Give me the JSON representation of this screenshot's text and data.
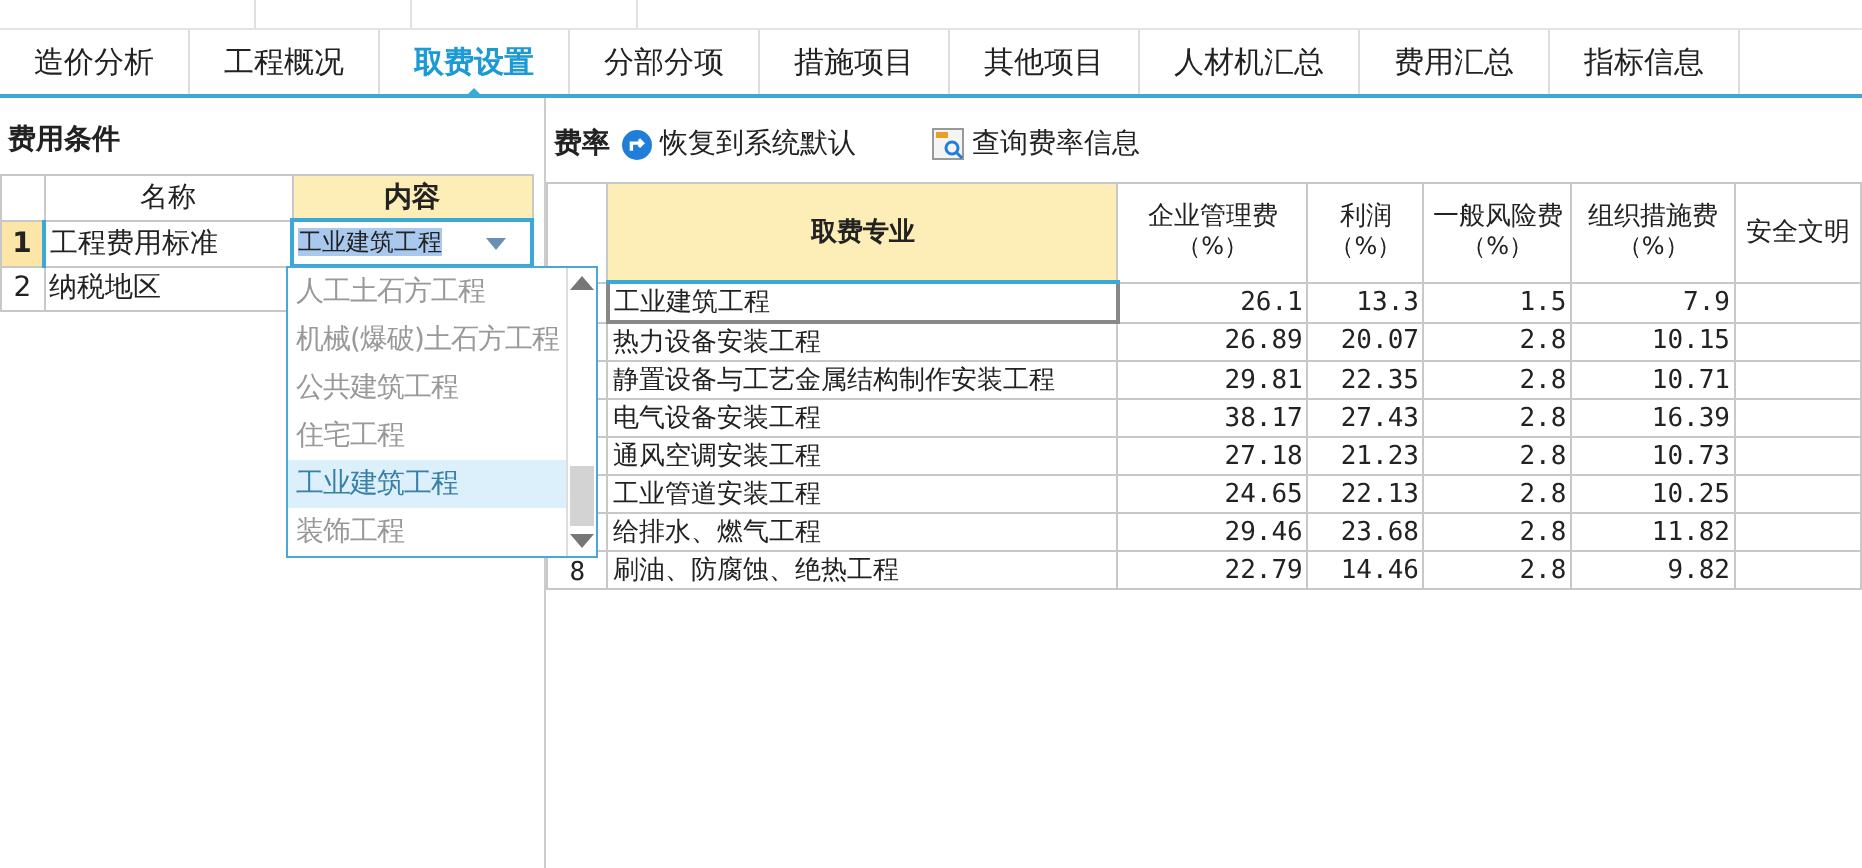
{
  "tabs": [
    {
      "label": "造价分析",
      "selected": false
    },
    {
      "label": "工程概况",
      "selected": false
    },
    {
      "label": "取费设置",
      "selected": true
    },
    {
      "label": "分部分项",
      "selected": false
    },
    {
      "label": "措施项目",
      "selected": false
    },
    {
      "label": "其他项目",
      "selected": false
    },
    {
      "label": "人材机汇总",
      "selected": false
    },
    {
      "label": "费用汇总",
      "selected": false
    },
    {
      "label": "指标信息",
      "selected": false
    }
  ],
  "conditions": {
    "title": "费用条件",
    "columns": [
      "名称",
      "内容"
    ],
    "rows": [
      {
        "index": "1",
        "name": "工程费用标准",
        "value": "工业建筑工程",
        "selected": true
      },
      {
        "index": "2",
        "name": "纳税地区",
        "selected": false
      }
    ],
    "dropdown": {
      "options": [
        {
          "label": "人工土石方工程",
          "selected": false
        },
        {
          "label": "机械(爆破)土石方工程",
          "selected": false
        },
        {
          "label": "公共建筑工程",
          "selected": false
        },
        {
          "label": "住宅工程",
          "selected": false
        },
        {
          "label": "工业建筑工程",
          "selected": true
        },
        {
          "label": "装饰工程",
          "selected": false
        }
      ]
    }
  },
  "rates": {
    "title": "费率",
    "toolbar": [
      "恢复到系统默认",
      "查询费率信息"
    ],
    "columns": [
      {
        "title": "取费专业"
      },
      {
        "title": "企业管理费",
        "unit": "（%）"
      },
      {
        "title": "利润",
        "unit": "（%）"
      },
      {
        "title": "一般风险费",
        "unit": "（%）"
      },
      {
        "title": "组织措施费",
        "unit": "（%）"
      },
      {
        "title": "安全文明"
      }
    ],
    "rows": [
      {
        "cells": [
          "工业建筑工程",
          "26.1",
          "13.3",
          "1.5",
          "7.9"
        ],
        "selected": true
      },
      {
        "cells": [
          "热力设备安装工程",
          "26.89",
          "20.07",
          "2.8",
          "10.15"
        ],
        "selected": false
      },
      {
        "cells": [
          "静置设备与工艺金属结构制作安装工程",
          "29.81",
          "22.35",
          "2.8",
          "10.71"
        ],
        "selected": false
      },
      {
        "cells": [
          "电气设备安装工程",
          "38.17",
          "27.43",
          "2.8",
          "16.39"
        ],
        "selected": false
      },
      {
        "cells": [
          "通风空调安装工程",
          "27.18",
          "21.23",
          "2.8",
          "10.73"
        ],
        "selected": false
      },
      {
        "cells": [
          "工业管道安装工程",
          "24.65",
          "22.13",
          "2.8",
          "10.25"
        ],
        "selected": false
      },
      {
        "cells": [
          "给排水、燃气工程",
          "29.46",
          "23.68",
          "2.8",
          "11.82"
        ],
        "selected": false
      },
      {
        "cells": [
          "刷油、防腐蚀、绝热工程",
          "22.79",
          "14.46",
          "2.8",
          "9.82"
        ],
        "selected": false,
        "row_number": "8"
      }
    ]
  }
}
